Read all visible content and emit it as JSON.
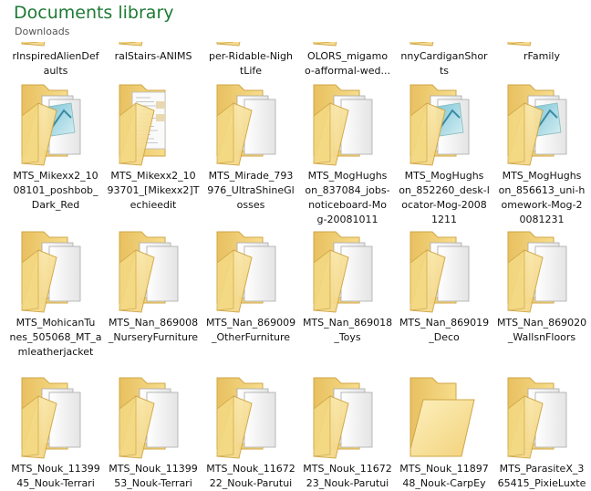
{
  "header": {
    "title": "Documents library",
    "subtitle": "Downloads"
  },
  "rows": [
    {
      "cut_off_top": true,
      "items": [
        {
          "label": "rInspiredAlienDef\naults",
          "icon": "folder-icon"
        },
        {
          "label": "ralStairs-ANIMS",
          "icon": "folder-icon"
        },
        {
          "label": "per-Ridable-Nigh\ntLife",
          "icon": "folder-icon"
        },
        {
          "label": "OLORS_migamo\no-afformal-wed...",
          "icon": "folder-icon"
        },
        {
          "label": "nnyCardiganShor\nts",
          "icon": "folder-icon"
        },
        {
          "label": "rFamily",
          "icon": "folder-icon"
        }
      ]
    },
    {
      "items": [
        {
          "label": "MTS_Mikexx2_10\n08101_poshbob_\nDark_Red",
          "icon": "folder-with-document-icon",
          "variant": "preview"
        },
        {
          "label": "MTS_Mikexx2_10\n93701_[Mikexx2]T\nechieedit",
          "icon": "folder-with-pages-icon",
          "variant": "pages"
        },
        {
          "label": "MTS_Mirade_793\n976_UltraShineGl\nosses",
          "icon": "folder-with-files-icon",
          "variant": "files"
        },
        {
          "label": "MTS_MogHughs\non_837084_jobs-\nnoticeboard-Mo\ng-20081011",
          "icon": "folder-with-files-icon",
          "variant": "files"
        },
        {
          "label": "MTS_MogHughs\non_852260_desk-l\nocator-Mog-2008\n1211",
          "icon": "folder-with-document-icon",
          "variant": "preview"
        },
        {
          "label": "MTS_MogHughs\non_856613_uni-h\nomework-Mog-2\n0081231",
          "icon": "folder-with-document-icon",
          "variant": "preview"
        }
      ]
    },
    {
      "items": [
        {
          "label": "MTS_MohicanTu\nnes_505068_MT_a\nmleatherjacket",
          "icon": "folder-with-files-icon",
          "variant": "files"
        },
        {
          "label": "MTS_Nan_869008\n_NurseryFurniture",
          "icon": "folder-with-files-icon",
          "variant": "files"
        },
        {
          "label": "MTS_Nan_869009\n_OtherFurniture",
          "icon": "folder-with-files-icon",
          "variant": "files"
        },
        {
          "label": "MTS_Nan_869018\n_Toys",
          "icon": "folder-with-files-icon",
          "variant": "files"
        },
        {
          "label": "MTS_Nan_869019\n_Deco",
          "icon": "folder-with-files-icon",
          "variant": "files"
        },
        {
          "label": "MTS_Nan_869020\n_WallsnFloors",
          "icon": "folder-with-files-icon",
          "variant": "files"
        }
      ]
    },
    {
      "cut_off_bottom": true,
      "items": [
        {
          "label": "MTS_Nouk_11399\n45_Nouk-Terrari",
          "icon": "folder-with-files-icon",
          "variant": "files"
        },
        {
          "label": "MTS_Nouk_11399\n53_Nouk-Terrari",
          "icon": "folder-with-files-icon",
          "variant": "files"
        },
        {
          "label": "MTS_Nouk_11672\n22_Nouk-Parutui",
          "icon": "folder-with-files-icon",
          "variant": "files"
        },
        {
          "label": "MTS_Nouk_11672\n23_Nouk-Parutui",
          "icon": "folder-with-files-icon",
          "variant": "files"
        },
        {
          "label": "MTS_Nouk_11897\n48_Nouk-CarpEy",
          "icon": "empty-folder-icon",
          "variant": "empty"
        },
        {
          "label": "MTS_ParasiteX_3\n65415_PixieLuxte",
          "icon": "folder-with-files-icon",
          "variant": "files"
        }
      ]
    }
  ],
  "colors": {
    "title_green": "#1e7a35",
    "folder_light": "#fbe9a8",
    "folder_dark": "#e9c463",
    "folder_edge": "#cfa646"
  }
}
